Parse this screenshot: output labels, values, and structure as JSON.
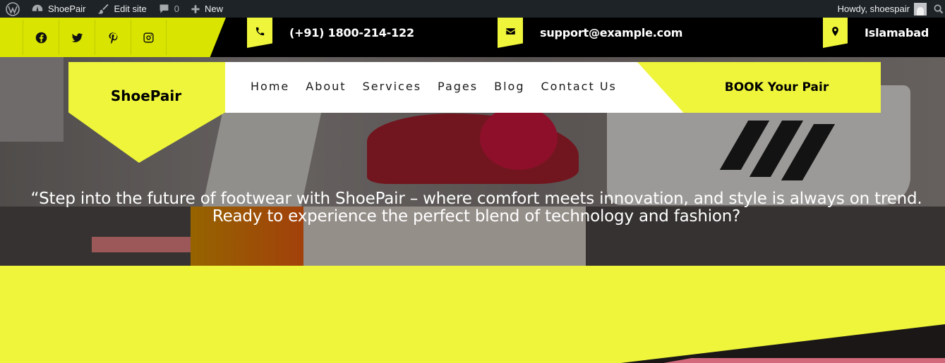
{
  "adminbar": {
    "site_name": "ShoePair",
    "edit_site": "Edit site",
    "comments_count": "0",
    "new_label": "New",
    "howdy": "Howdy, shoespair"
  },
  "social": {
    "icons": [
      "facebook-icon",
      "twitter-icon",
      "pinterest-icon",
      "instagram-icon"
    ]
  },
  "contact": {
    "phone": "(+91) 1800-214-122",
    "email": "support@example.com",
    "location": "Islamabad"
  },
  "header": {
    "logo": "ShoePair",
    "nav": [
      "Home",
      "About",
      "Services",
      "Pages",
      "Blog",
      "Contact Us"
    ],
    "cta": "BOOK Your Pair"
  },
  "hero": {
    "tagline": "“Step into the future of footwear with ShoePair – where comfort meets innovation, and style is always on trend. Ready to experience the perfect blend of technology and fashion?"
  },
  "colors": {
    "accent": "#eef53a",
    "adminbar": "#1d2327",
    "topbar": "#000000"
  }
}
